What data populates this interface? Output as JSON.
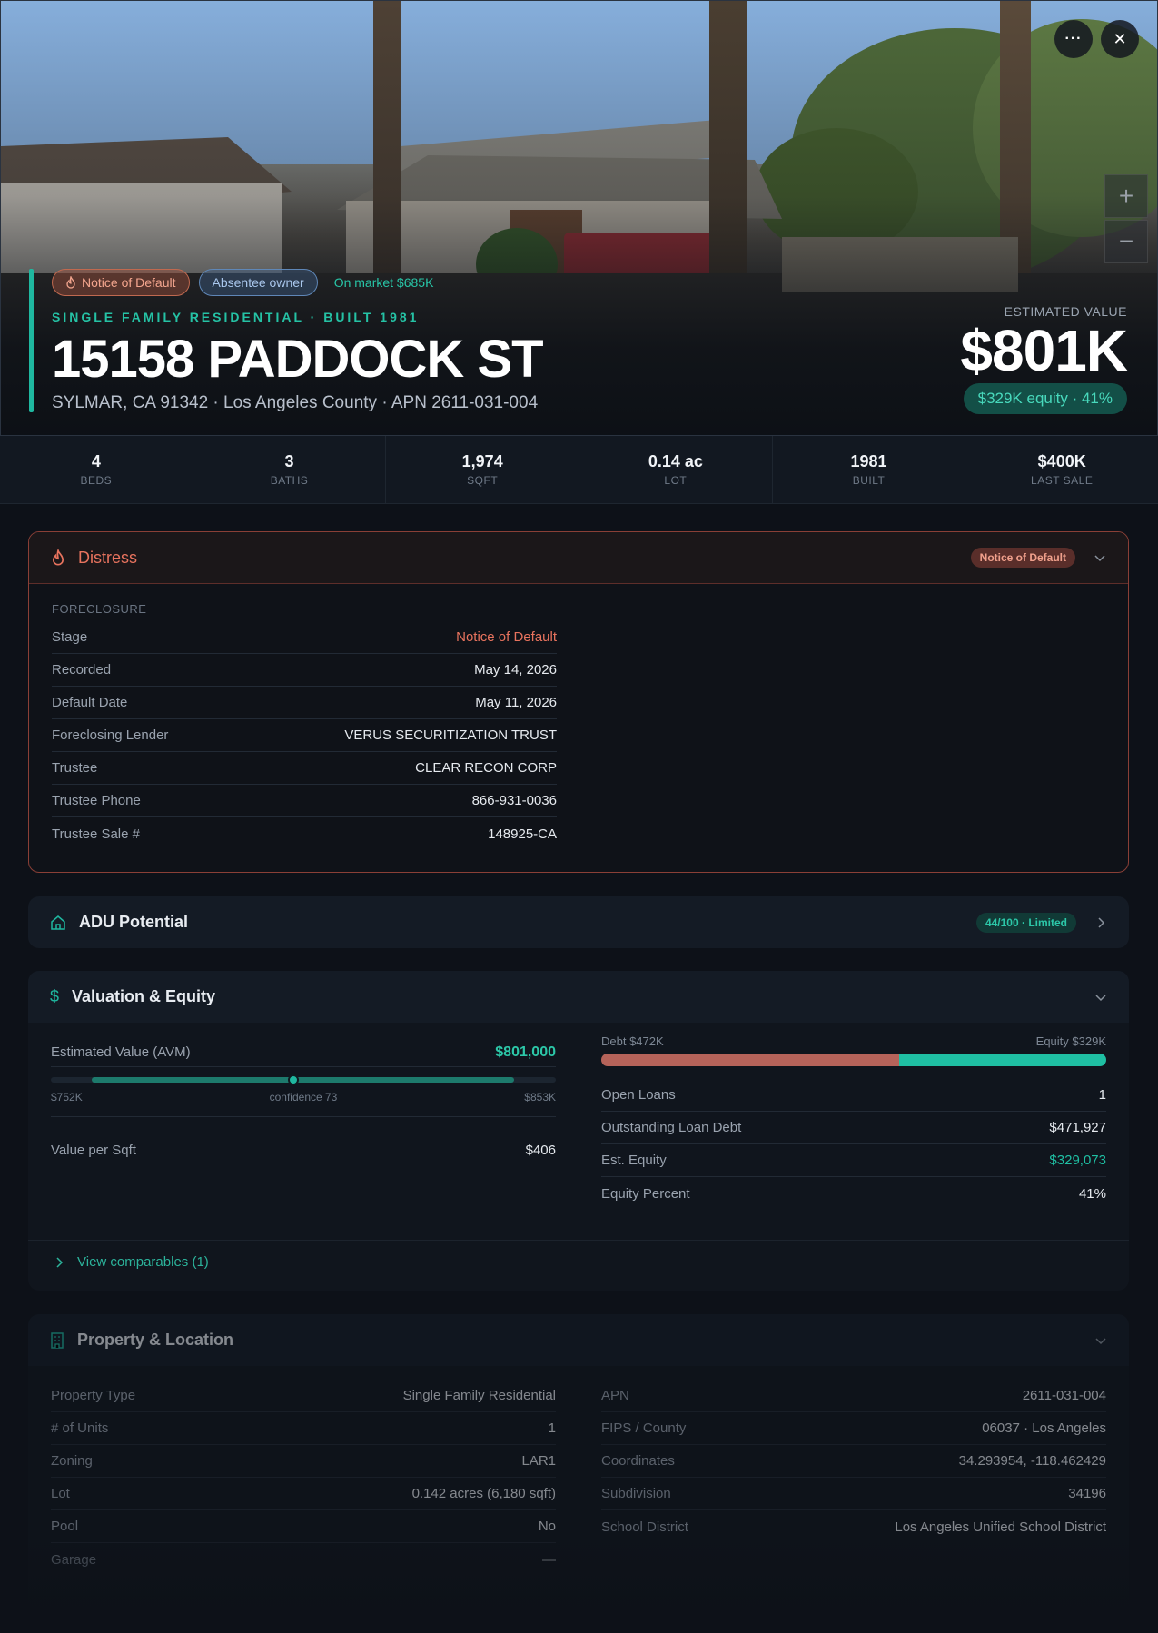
{
  "hero": {
    "badges": {
      "distress": "Notice of Default",
      "absentee": "Absentee owner",
      "market": "On market $685K"
    },
    "subtitle": "SINGLE FAMILY RESIDENTIAL · BUILT 1981",
    "title": "15158 PADDOCK ST",
    "address_line": "SYLMAR, CA 91342 · Los Angeles County · APN 2611-031-004",
    "estimated_label": "ESTIMATED VALUE",
    "estimated_value": "$801K",
    "equity_pill": "$329K equity · 41%"
  },
  "controls": {
    "more": "···",
    "close": "✕",
    "zoom_in": "+",
    "zoom_out": "−"
  },
  "stats": [
    {
      "value": "4",
      "label": "BEDS"
    },
    {
      "value": "3",
      "label": "BATHS"
    },
    {
      "value": "1,974",
      "label": "SQFT"
    },
    {
      "value": "0.14 ac",
      "label": "LOT"
    },
    {
      "value": "1981",
      "label": "BUILT"
    },
    {
      "value": "$400K",
      "label": "LAST SALE"
    }
  ],
  "distress": {
    "title": "Distress",
    "badge": "Notice of Default",
    "section_caption": "FORECLOSURE",
    "rows": [
      {
        "k": "Stage",
        "v": "Notice of Default"
      },
      {
        "k": "Recorded",
        "v": "May 14, 2026"
      },
      {
        "k": "Default Date",
        "v": "May 11, 2026"
      },
      {
        "k": "Foreclosing Lender",
        "v": "VERUS SECURITIZATION TRUST"
      },
      {
        "k": "Trustee",
        "v": "CLEAR RECON CORP"
      },
      {
        "k": "Trustee Phone",
        "v": "866-931-0036"
      },
      {
        "k": "Trustee Sale #",
        "v": "148925-CA"
      }
    ]
  },
  "adu": {
    "title": "ADU Potential",
    "badge": "44/100 · Limited"
  },
  "valuation": {
    "title": "Valuation & Equity",
    "avm_label": "Estimated Value (AVM)",
    "avm_value": "$801,000",
    "range_low": "$752K",
    "range_high": "$853K",
    "confidence_text": "confidence 73",
    "range_marker_fraction": 0.48,
    "value_per_sqft_label": "Value per Sqft",
    "value_per_sqft": "$406",
    "debt_label": "Debt $472K",
    "equity_label": "Equity $329K",
    "debt_fraction": 0.59,
    "rows": [
      {
        "k": "Open Loans",
        "v": "1"
      },
      {
        "k": "Outstanding Loan Debt",
        "v": "$471,927"
      },
      {
        "k": "Est. Equity",
        "v": "$329,073"
      },
      {
        "k": "Equity Percent",
        "v": "41%"
      }
    ],
    "comparables_link": "View comparables (1)"
  },
  "property": {
    "title": "Property & Location",
    "left_rows": [
      {
        "k": "Property Type",
        "v": "Single Family Residential"
      },
      {
        "k": "# of Units",
        "v": "1"
      },
      {
        "k": "Zoning",
        "v": "LAR1"
      },
      {
        "k": "Lot",
        "v": "0.142 acres (6,180 sqft)"
      },
      {
        "k": "Pool",
        "v": "No"
      },
      {
        "k": "Garage",
        "v": "—"
      }
    ],
    "right_rows": [
      {
        "k": "APN",
        "v": "2611-031-004"
      },
      {
        "k": "FIPS / County",
        "v": "06037 · Los Angeles"
      },
      {
        "k": "Coordinates",
        "v": "34.293954, -118.462429"
      },
      {
        "k": "Subdivision",
        "v": "34196"
      },
      {
        "k": "School District",
        "v": "Los Angeles Unified School District"
      }
    ]
  },
  "colors": {
    "accent": "#1fb8a0",
    "distress": "#e8735e",
    "debt": "#b5635a",
    "equity": "#1fbfa3"
  }
}
